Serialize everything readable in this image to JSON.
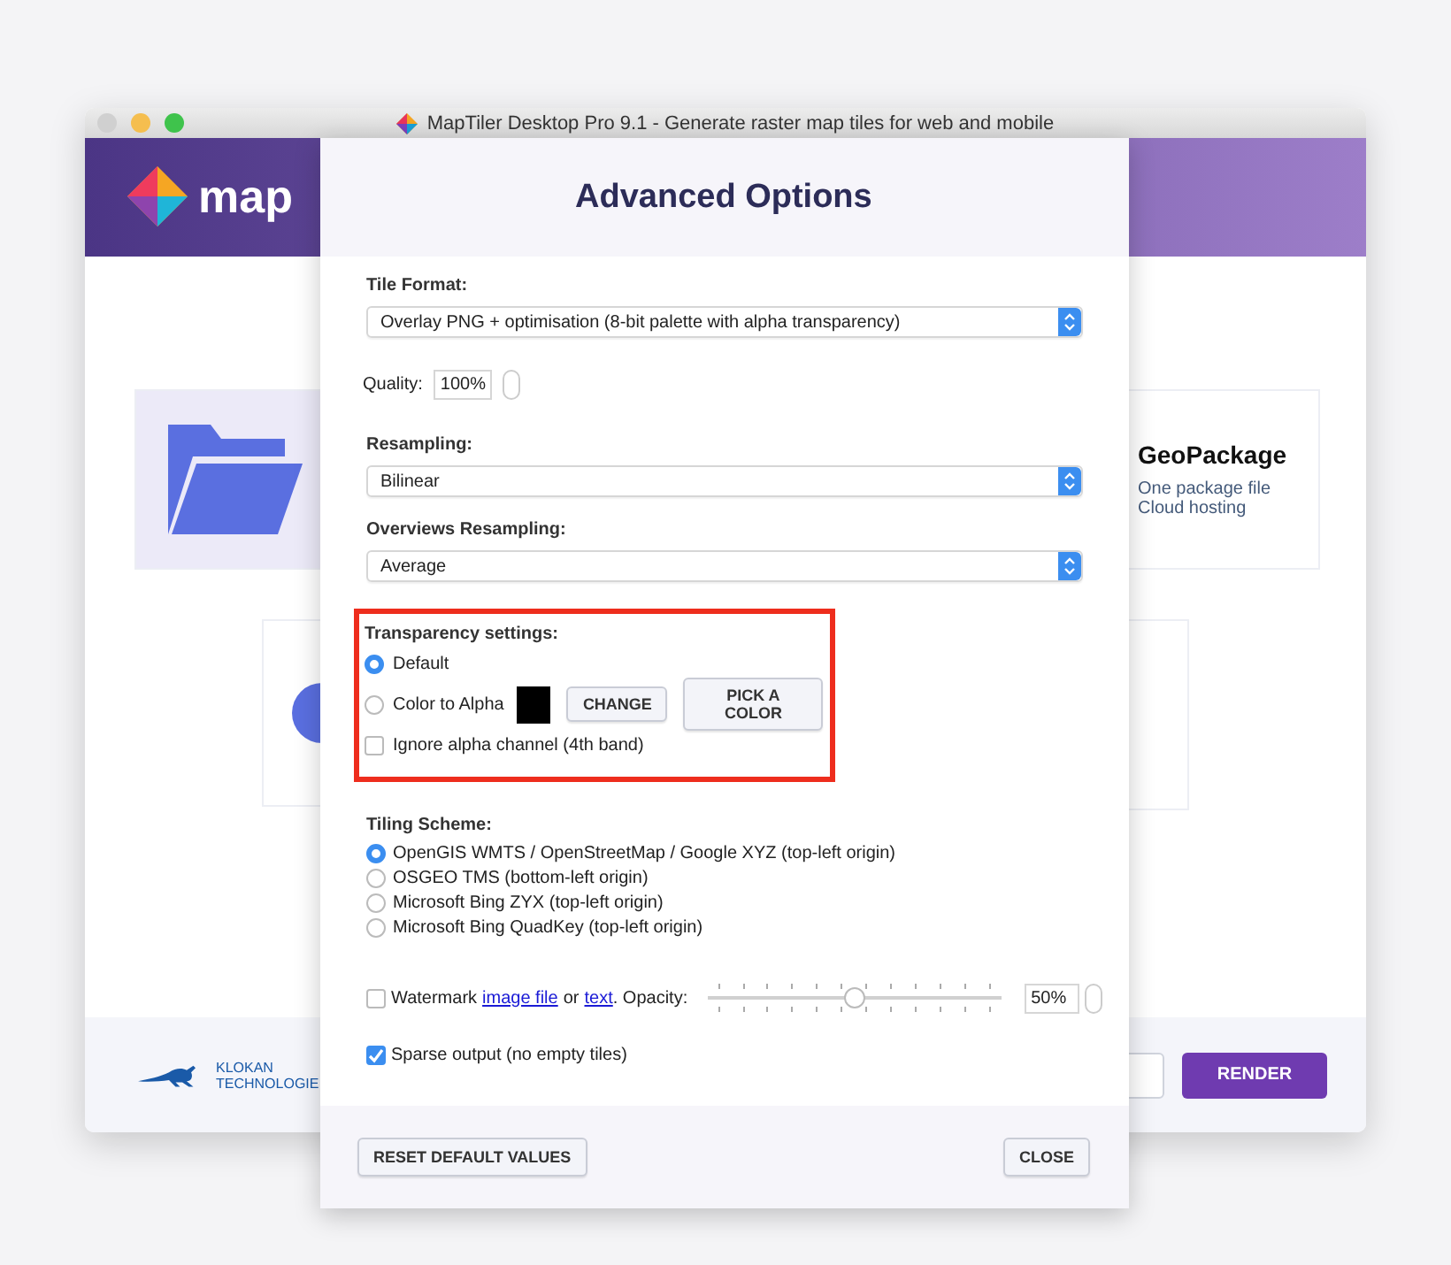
{
  "window": {
    "title": "MapTiler Desktop Pro 9.1 - Generate raster map tiles for web and mobile"
  },
  "header": {
    "logo_text": "map"
  },
  "background_card": {
    "title": "GeoPackage",
    "lines": [
      "One package file",
      "Cloud hosting"
    ]
  },
  "footer": {
    "company_lines": [
      "KLOKAN",
      "TECHNOLOGIE"
    ],
    "render_button": "RENDER"
  },
  "dialog": {
    "title": "Advanced Options",
    "tile_format": {
      "label": "Tile Format:",
      "value": "Overlay PNG + optimisation (8-bit palette with alpha transparency)"
    },
    "quality": {
      "label": "Quality:",
      "value": "100%"
    },
    "resampling": {
      "label": "Resampling:",
      "value": "Bilinear"
    },
    "overviews_resampling": {
      "label": "Overviews Resampling:",
      "value": "Average"
    },
    "transparency": {
      "label": "Transparency settings:",
      "options": [
        {
          "label": "Default",
          "selected": true
        },
        {
          "label": "Color to Alpha",
          "selected": false
        }
      ],
      "change_button": "CHANGE",
      "pick_button": "PICK A COLOR",
      "ignore_alpha": {
        "label": "Ignore alpha channel (4th band)",
        "checked": false
      }
    },
    "tiling_scheme": {
      "label": "Tiling Scheme:",
      "options": [
        {
          "label": "OpenGIS WMTS / OpenStreetMap / Google XYZ (top-left origin)",
          "selected": true
        },
        {
          "label": "OSGEO TMS (bottom-left origin)",
          "selected": false
        },
        {
          "label": "Microsoft Bing ZYX (top-left origin)",
          "selected": false
        },
        {
          "label": "Microsoft Bing QuadKey (top-left origin)",
          "selected": false
        }
      ]
    },
    "watermark": {
      "checked": false,
      "before": "Watermark",
      "link1": "image file",
      "middle": "or",
      "link2": "text",
      "after": ". Opacity:",
      "level": 0.5,
      "value": "50%"
    },
    "sparse": {
      "label": "Sparse output (no empty tiles)",
      "checked": true
    },
    "reset_button": "RESET DEFAULT VALUES",
    "close_button": "CLOSE"
  }
}
